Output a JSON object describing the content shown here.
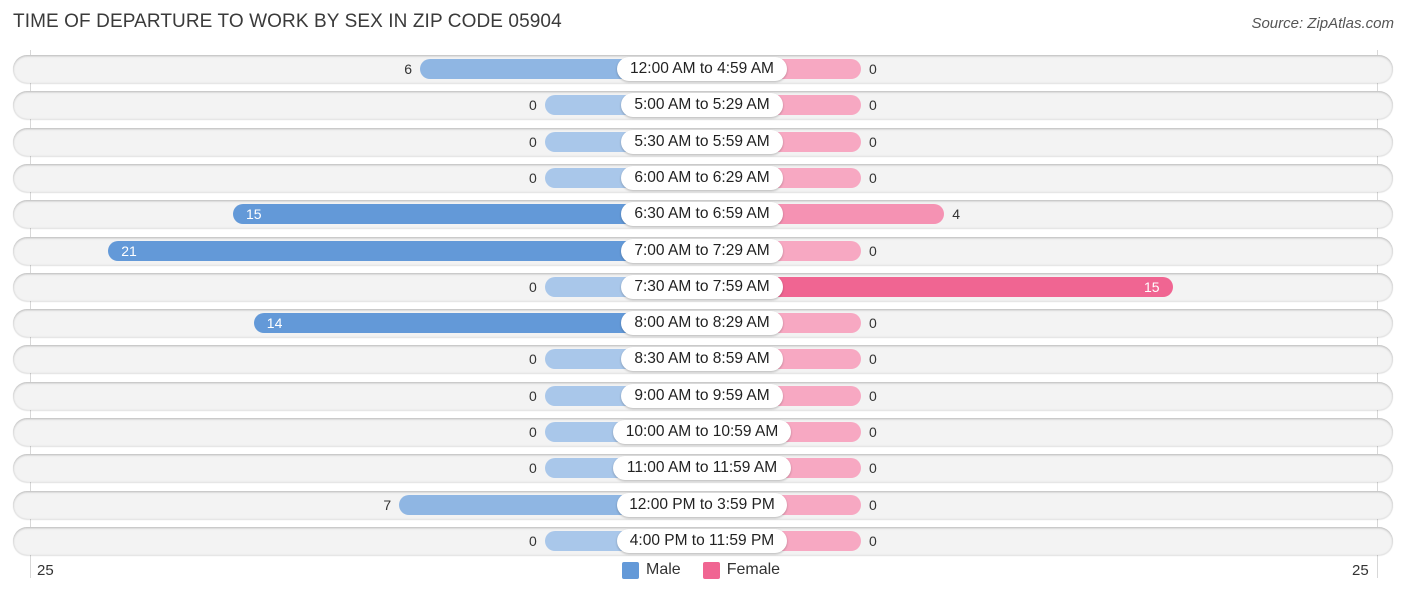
{
  "header": {
    "title": "TIME OF DEPARTURE TO WORK BY SEX IN ZIP CODE 05904",
    "source": "Source: ZipAtlas.com"
  },
  "colors": {
    "male_strong": "#6399d8",
    "male_light": "#a9c7ea",
    "female_strong": "#f06592",
    "female_light": "#f7a8c2"
  },
  "chart_data": {
    "type": "bar",
    "orientation": "horizontal-diverging",
    "title": "TIME OF DEPARTURE TO WORK BY SEX IN ZIP CODE 05904",
    "categories": [
      "12:00 AM to 4:59 AM",
      "5:00 AM to 5:29 AM",
      "5:30 AM to 5:59 AM",
      "6:00 AM to 6:29 AM",
      "6:30 AM to 6:59 AM",
      "7:00 AM to 7:29 AM",
      "7:30 AM to 7:59 AM",
      "8:00 AM to 8:29 AM",
      "8:30 AM to 8:59 AM",
      "9:00 AM to 9:59 AM",
      "10:00 AM to 10:59 AM",
      "11:00 AM to 11:59 AM",
      "12:00 PM to 3:59 PM",
      "4:00 PM to 11:59 PM"
    ],
    "series": [
      {
        "name": "Male",
        "values": [
          6,
          0,
          0,
          0,
          15,
          21,
          0,
          14,
          0,
          0,
          0,
          0,
          7,
          0
        ]
      },
      {
        "name": "Female",
        "values": [
          0,
          0,
          0,
          0,
          4,
          0,
          15,
          0,
          0,
          0,
          0,
          0,
          0,
          0
        ]
      }
    ],
    "axis": {
      "min_label": "25",
      "max_label": "25",
      "range": [
        -25,
        25
      ]
    },
    "legend": {
      "position": "bottom-center",
      "entries": [
        "Male",
        "Female"
      ]
    },
    "xlabel": "",
    "ylabel": ""
  }
}
